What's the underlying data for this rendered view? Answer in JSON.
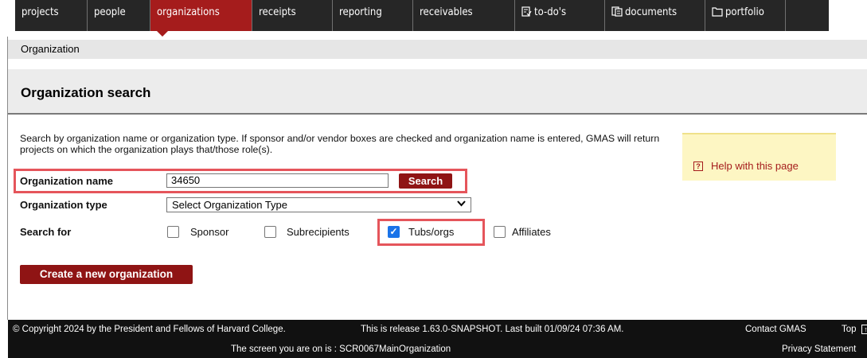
{
  "nav": {
    "items": [
      {
        "label": "projects",
        "icon": ""
      },
      {
        "label": "people",
        "icon": ""
      },
      {
        "label": "organizations",
        "icon": "",
        "active": true
      },
      {
        "label": "receipts",
        "icon": ""
      },
      {
        "label": "reporting",
        "icon": ""
      },
      {
        "label": "receivables",
        "icon": ""
      },
      {
        "label": "to-do's",
        "icon": "checklist-icon"
      },
      {
        "label": "documents",
        "icon": "documents-icon"
      },
      {
        "label": "portfolio",
        "icon": "folder-icon"
      }
    ]
  },
  "breadcrumb": "Organization",
  "page_title": "Organization search",
  "description": "Search by organization name or organization type. If sponsor and/or vendor boxes are checked and organization name is entered, GMAS will return projects on which the organization plays that/those role(s).",
  "help": {
    "label": "Help with this page",
    "icon": "help-icon"
  },
  "form": {
    "name_label": "Organization name",
    "name_value": "34650",
    "search_button": "Search",
    "type_label": "Organization type",
    "type_selected": "Select Organization Type",
    "search_for_label": "Search for",
    "options": [
      {
        "label": "Sponsor",
        "checked": false
      },
      {
        "label": "Subrecipients",
        "checked": false
      },
      {
        "label": "Tubs/orgs",
        "checked": true
      },
      {
        "label": "Affiliates",
        "checked": false
      }
    ]
  },
  "create_button": "Create a new organization",
  "footer": {
    "copyright": "© Copyright 2024 by the President and Fellows of Harvard College.",
    "release": "This is release 1.63.0-SNAPSHOT. Last built 01/09/24 07:36 AM.",
    "contact": "Contact GMAS",
    "top": "Top",
    "screen": "The screen you are on is : SCR0067MainOrganization",
    "privacy": "Privacy Statement"
  },
  "colors": {
    "nav_background": "#262626",
    "accent": "#a51c1c",
    "highlight_border": "#e5555b",
    "help_background": "#fdf6c3",
    "checkbox_checked": "#1a73e8"
  }
}
